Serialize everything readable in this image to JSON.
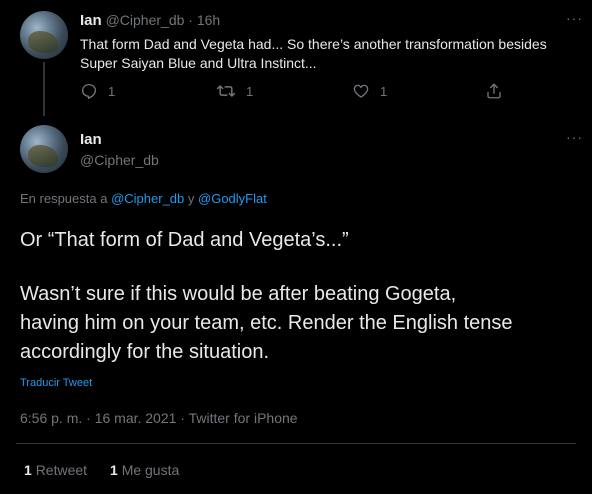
{
  "tweet1": {
    "name": "Ian",
    "handle": "@Cipher_db",
    "separator": "·",
    "time": "16h",
    "text_line1": "That form Dad and Vegeta had... So there’s another transformation besides",
    "text_line2": "Super Saiyan Blue and Ultra Instinct...",
    "reply_count": "1",
    "retweet_count": "1",
    "like_count": "1"
  },
  "tweet2": {
    "name": "Ian",
    "handle": "@Cipher_db",
    "reply_prefix": "En respuesta a",
    "reply_user1": "@Cipher_db",
    "reply_conj": "y",
    "reply_user2": "@GodlyFlat",
    "line1": "Or “That form of Dad and Vegeta’s...”",
    "line2": "Wasn’t sure if this would be after beating Gogeta,",
    "line3": "having him on your team, etc. Render the English tense",
    "line4": "accordingly for the situation.",
    "translate": "Traducir Tweet",
    "meta": "6:56 p. m. · 16 mar. 2021 · Twitter for iPhone",
    "retweets_count": "1",
    "retweets_label": "Retweet",
    "likes_count": "1",
    "likes_label": "Me gusta"
  },
  "colors": {
    "background": "#000000",
    "text": "#e7e9ea",
    "muted": "#71767b",
    "link": "#1d9bf0",
    "divider": "#2f3336"
  },
  "icons": [
    "more-icon",
    "reply-icon",
    "retweet-icon",
    "like-icon",
    "share-icon"
  ]
}
